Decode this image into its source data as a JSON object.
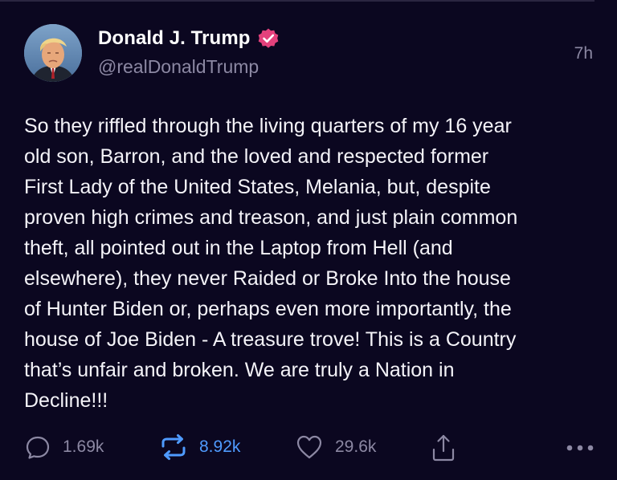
{
  "post": {
    "author": {
      "display_name": "Donald J. Trump",
      "handle": "@realDonaldTrump",
      "verified": true,
      "verified_color": "#e3417c"
    },
    "timestamp": "7h",
    "text": "So they riffled through the living quarters of my 16 year\nold son, Barron, and the loved and respected former\nFirst Lady of the United States, Melania, but, despite\nproven high crimes and treason, and just plain common\ntheft, all pointed out in the Laptop from Hell (and\nelsewhere), they never Raided or Broke Into the house\nof Hunter Biden or, perhaps even more importantly, the\nhouse of Joe Biden - A treasure trove! This is a Country\nthat’s unfair and broken. We are truly a Nation in\nDecline!!!",
    "actions": {
      "replies": "1.69k",
      "retweets": "8.92k",
      "likes": "29.6k"
    }
  },
  "colors": {
    "background": "#0b0720",
    "text": "#f4f3f8",
    "muted": "#8c88a3",
    "retweet_active": "#4f9bff"
  },
  "icons": {
    "reply": "reply-icon",
    "retweet": "retweet-icon",
    "like": "heart-icon",
    "share": "share-icon",
    "more": "more-icon"
  }
}
